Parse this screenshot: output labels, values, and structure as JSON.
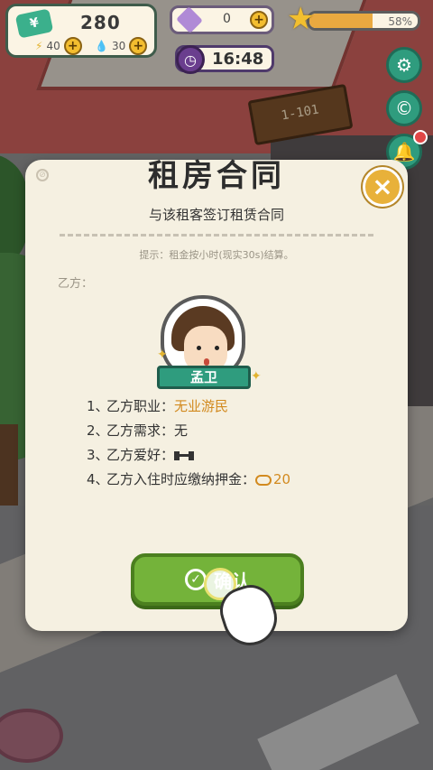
{
  "hud": {
    "cash": "280",
    "cash_icon": "cash-icon",
    "energy": "40",
    "water": "30",
    "gems": "0",
    "level_progress_pct": 58,
    "level_progress_label": "58%",
    "time": "16:48"
  },
  "scene": {
    "sign_text": "1-101"
  },
  "side_buttons": [
    "gear-icon",
    "coin-icon",
    "bell-icon"
  ],
  "dialog": {
    "title": "租房合同",
    "subtitle": "与该租客签订租赁合同",
    "hint": "提示：租金按小时(现实30s)结算。",
    "party_label": "乙方：",
    "tenant_name": "孟卫",
    "requirements": [
      {
        "num": "1、",
        "label": "乙方职业：",
        "value": "无业游民"
      },
      {
        "num": "2、",
        "label": "乙方需求：",
        "value": "无"
      },
      {
        "num": "3、",
        "label": "乙方爱好：",
        "value": ""
      },
      {
        "num": "4、",
        "label": "乙方入住时应缴纳押金：",
        "value": "20"
      }
    ],
    "confirm_label": "确认",
    "close_symbol": "×"
  },
  "colors": {
    "accent_green": "#74b33a",
    "close_yellow": "#e8b13a",
    "highlight_orange": "#d28a1f",
    "dialog_bg": "#f5f0e1"
  }
}
